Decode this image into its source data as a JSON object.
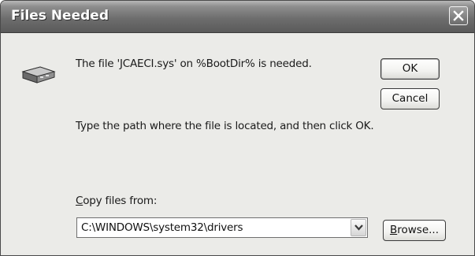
{
  "window": {
    "title": "Files Needed"
  },
  "message": {
    "main": "The file 'JCAECI.sys' on %BootDir% is needed.",
    "instruction": "Type the path where the file is located, and then click OK."
  },
  "buttons": {
    "ok": "OK",
    "cancel": "Cancel",
    "browse_mnemonic": "B",
    "browse_rest": "rowse..."
  },
  "copy_from": {
    "label_mnemonic": "C",
    "label_rest": "opy files from:",
    "value": "C:\\WINDOWS\\system32\\drivers"
  },
  "icons": {
    "disk": "hard-disk-icon",
    "close": "close-icon",
    "dropdown": "chevron-down-icon"
  }
}
